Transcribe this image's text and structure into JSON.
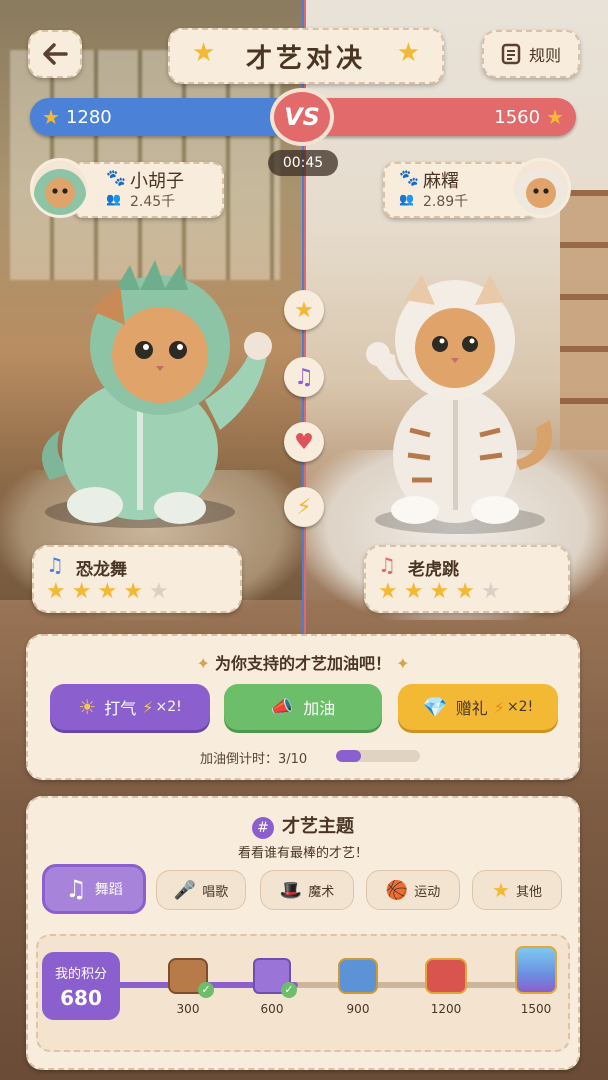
{
  "header": {
    "title": "才艺对决",
    "back_icon": "back-arrow-icon",
    "rules_label": "规则"
  },
  "score": {
    "left": "1280",
    "right": "1560",
    "vs": "VS",
    "timer": "00:45",
    "left_color": "#4b82d8",
    "right_color": "#e36a6a"
  },
  "players": [
    {
      "name": "小胡子",
      "followers": "2.45千"
    },
    {
      "name": "麻糬",
      "followers": "2.89千"
    }
  ],
  "side_icons": [
    "star-icon",
    "music-note-icon",
    "heart-icon",
    "lightning-icon"
  ],
  "talents": [
    {
      "name": "恐龙舞",
      "rating": 4,
      "max": 5
    },
    {
      "name": "老虎跳",
      "rating": 4,
      "max": 5
    }
  ],
  "support": {
    "title": "为你支持的才艺加油吧！",
    "buttons": [
      {
        "label": "打气",
        "multiplier": "×2!",
        "color": "#8b5fce"
      },
      {
        "label": "加油",
        "multiplier": "",
        "color": "#6cbe6a"
      },
      {
        "label": "赠礼",
        "multiplier": "×2!",
        "color": "#f3b935"
      }
    ],
    "countdown_label": "加油倒计时：3/10",
    "countdown_fraction": 0.3
  },
  "theme": {
    "title": "才艺主题",
    "subtitle": "看看谁有最棒的才艺！",
    "tabs": [
      {
        "label": "舞蹈",
        "icon": "music-note-icon",
        "active": true
      },
      {
        "label": "唱歌",
        "icon": "microphone-icon",
        "active": false
      },
      {
        "label": "魔术",
        "icon": "magic-hat-icon",
        "active": false
      },
      {
        "label": "运动",
        "icon": "ball-icon",
        "active": false
      },
      {
        "label": "其他",
        "icon": "star-icon",
        "active": false
      }
    ]
  },
  "progress": {
    "label": "我的积分",
    "value": "680",
    "milestones": [
      {
        "points": "300",
        "claimed": true
      },
      {
        "points": "600",
        "claimed": true
      },
      {
        "points": "900",
        "claimed": false
      },
      {
        "points": "1200",
        "claimed": false
      },
      {
        "points": "1500",
        "claimed": false
      }
    ]
  }
}
